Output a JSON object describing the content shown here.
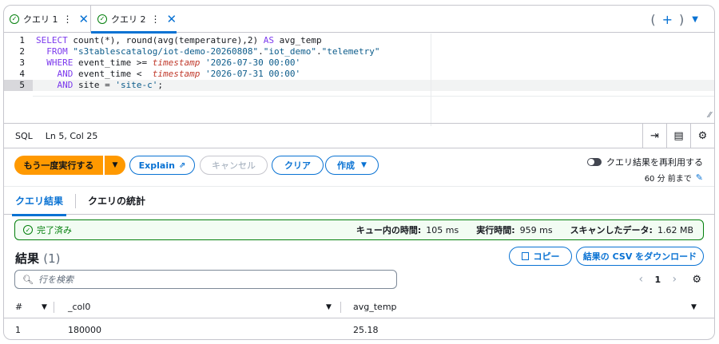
{
  "tabs": [
    {
      "label": "クエリ 1",
      "dots": "⋮",
      "close": "✕"
    },
    {
      "label": "クエリ 2",
      "dots": "⋮",
      "close": "✕"
    }
  ],
  "tab_controls": {
    "open_paren": "(",
    "add": "+",
    "close_paren": ")",
    "menu": "▼"
  },
  "editor": {
    "line_numbers": [
      "1",
      "2",
      "3",
      "4",
      "5"
    ],
    "lines": [
      "SELECT count(*), round(avg(temperature),2) AS avg_temp",
      "  FROM \"s3tablescatalog/iot-demo-20260808\".\"iot_demo\".\"telemetry\"",
      "  WHERE event_time >= timestamp '2026-07-30 00:00'",
      "    AND event_time <  timestamp '2026-07-31 00:00'",
      "    AND site = 'site-c';"
    ]
  },
  "status": {
    "language": "SQL",
    "position": "Ln 5, Col 25"
  },
  "actions": {
    "run": "もう一度実行する",
    "explain": "Explain",
    "cancel": "キャンセル",
    "clear": "クリア",
    "create": "作成",
    "reuse_label": "クエリ結果を再利用する",
    "reuse_sub": "60 分 前まで"
  },
  "result_tabs": {
    "results": "クエリ結果",
    "stats": "クエリの統計"
  },
  "banner": {
    "status": "完了済み",
    "queue_label": "キュー内の時間:",
    "queue_value": "105 ms",
    "exec_label": "実行時間:",
    "exec_value": "959 ms",
    "scan_label": "スキャンしたデータ:",
    "scan_value": "1.62 MB"
  },
  "results": {
    "title": "結果",
    "count": "(1)",
    "copy": "コピー",
    "download": "結果の CSV をダウンロード",
    "search_placeholder": "行を検索",
    "page": "1"
  },
  "table": {
    "columns": [
      "#",
      "_col0",
      "avg_temp"
    ],
    "rows": [
      [
        "1",
        "180000",
        "25.18"
      ]
    ]
  }
}
